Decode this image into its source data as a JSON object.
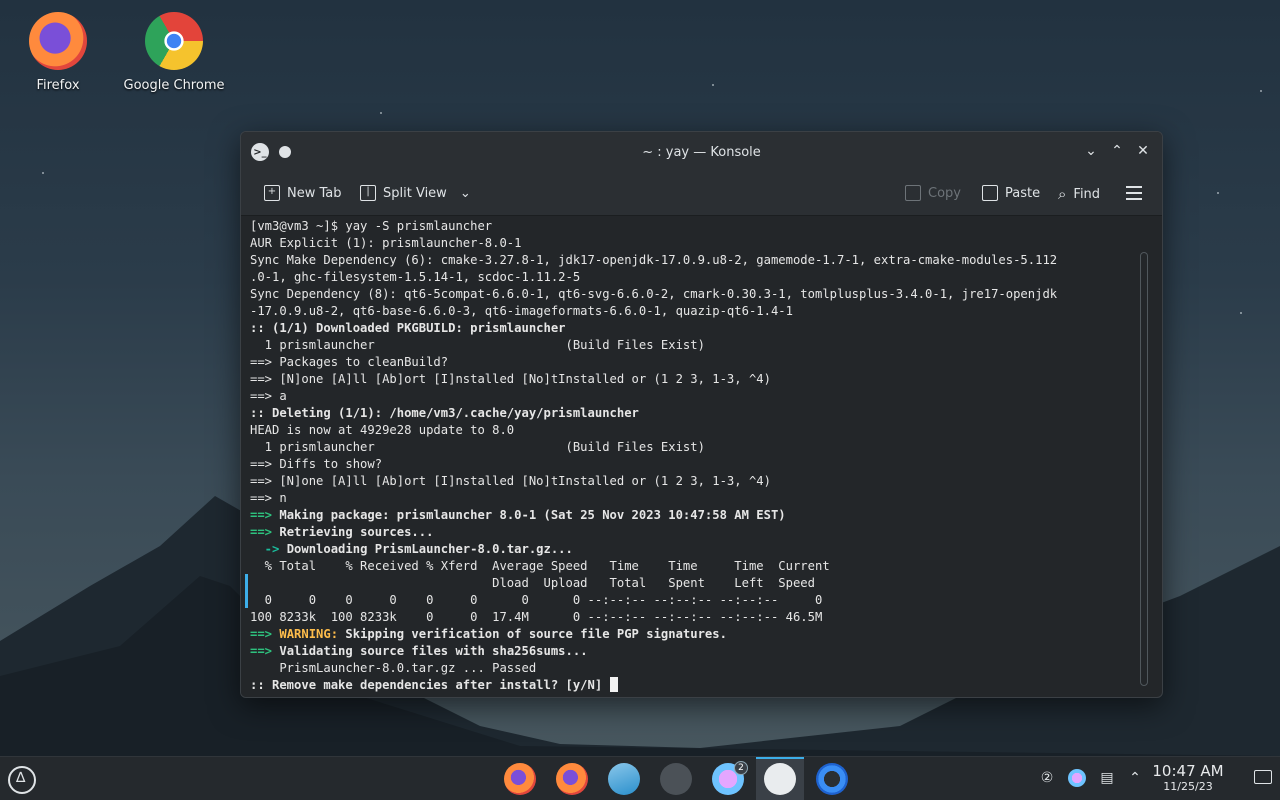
{
  "desktop": {
    "icons": [
      {
        "label": "Firefox"
      },
      {
        "label": "Google Chrome"
      }
    ]
  },
  "window": {
    "title": "~ : yay — Konsole",
    "toolbar": {
      "new_tab": "New Tab",
      "split_view": "Split View",
      "copy": "Copy",
      "paste": "Paste",
      "find": "Find"
    }
  },
  "terminal": {
    "lines": [
      {
        "t": "[vm3@vm3 ~]$ yay -S prismlauncher",
        "s": ""
      },
      {
        "t": "AUR Explicit (1): prismlauncher-8.0-1",
        "s": ""
      },
      {
        "t": "Sync Make Dependency (6): cmake-3.27.8-1, jdk17-openjdk-17.0.9.u8-2, gamemode-1.7-1, extra-cmake-modules-5.112",
        "s": ""
      },
      {
        "t": ".0-1, ghc-filesystem-1.5.14-1, scdoc-1.11.2-5",
        "s": ""
      },
      {
        "t": "Sync Dependency (8): qt6-5compat-6.6.0-1, qt6-svg-6.6.0-2, cmark-0.30.3-1, tomlplusplus-3.4.0-1, jre17-openjdk",
        "s": ""
      },
      {
        "t": "-17.0.9.u8-2, qt6-base-6.6.0-3, qt6-imageformats-6.6.0-1, quazip-qt6-1.4-1",
        "s": ""
      },
      {
        "t": ":: (1/1) Downloaded PKGBUILD: prismlauncher",
        "s": "b"
      },
      {
        "t": "  1 prismlauncher                          (Build Files Exist)",
        "s": ""
      },
      {
        "t": "==> Packages to cleanBuild?",
        "s": ""
      },
      {
        "t": "==> [N]one [A]ll [Ab]ort [I]nstalled [No]tInstalled or (1 2 3, 1-3, ^4)",
        "s": ""
      },
      {
        "t": "==> a",
        "s": ""
      },
      {
        "t": ":: Deleting (1/1): /home/vm3/.cache/yay/prismlauncher",
        "s": "b"
      },
      {
        "t": "HEAD is now at 4929e28 update to 8.0",
        "s": ""
      },
      {
        "t": "  1 prismlauncher                          (Build Files Exist)",
        "s": ""
      },
      {
        "t": "==> Diffs to show?",
        "s": ""
      },
      {
        "t": "==> [N]one [A]ll [Ab]ort [I]nstalled [No]tInstalled or (1 2 3, 1-3, ^4)",
        "s": ""
      },
      {
        "t": "==> n",
        "s": ""
      },
      {
        "p": "==>",
        "ps": "g",
        "t": " Making package: prismlauncher 8.0-1 (Sat 25 Nov 2023 10:47:58 AM EST)",
        "s": "b"
      },
      {
        "p": "==>",
        "ps": "g",
        "t": " Retrieving sources...",
        "s": "b"
      },
      {
        "p": "  ->",
        "ps": "c",
        "t": " Downloading PrismLauncher-8.0.tar.gz...",
        "s": "b"
      },
      {
        "t": "  % Total    % Received % Xferd  Average Speed   Time    Time     Time  Current",
        "s": ""
      },
      {
        "t": "                                 Dload  Upload   Total   Spent    Left  Speed",
        "s": ""
      },
      {
        "t": "  0     0    0     0    0     0      0      0 --:--:-- --:--:-- --:--:--     0",
        "s": ""
      },
      {
        "t": "100 8233k  100 8233k    0     0  17.4M      0 --:--:-- --:--:-- --:--:-- 46.5M",
        "s": ""
      },
      {
        "p": "==>",
        "ps": "g",
        "w": " WARNING:",
        "t": " Skipping verification of source file PGP signatures.",
        "s": "b"
      },
      {
        "p": "==>",
        "ps": "g",
        "t": " Validating source files with sha256sums...",
        "s": "b"
      },
      {
        "t": "    PrismLauncher-8.0.tar.gz ... Passed",
        "s": ""
      },
      {
        "t": ":: Remove make dependencies after install? [y/N] ",
        "s": "b",
        "cursor": true
      }
    ]
  },
  "taskbar": {
    "badge_count": "2",
    "clock_time": "10:47 AM",
    "clock_date": "11/25/23",
    "tray_clipboard_count": "②"
  }
}
